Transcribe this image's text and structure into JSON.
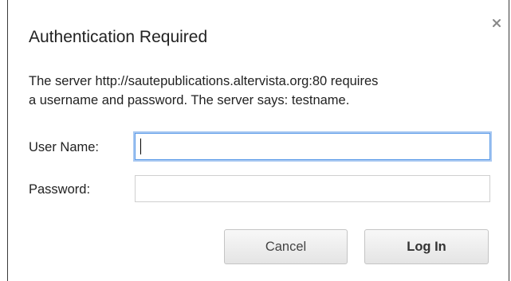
{
  "dialog": {
    "title": "Authentication Required",
    "message_line1": "The server http://sautepublications.altervista.org:80 requires",
    "message_line2": "a username and password. The server says: testname.",
    "close_icon": "close-icon"
  },
  "form": {
    "username_label": "User Name:",
    "username_value": "",
    "password_label": "Password:",
    "password_value": ""
  },
  "buttons": {
    "cancel_label": "Cancel",
    "login_label": "Log In"
  },
  "colors": {
    "focus_ring": "#5a9ae8",
    "border": "#cfcfcf"
  }
}
